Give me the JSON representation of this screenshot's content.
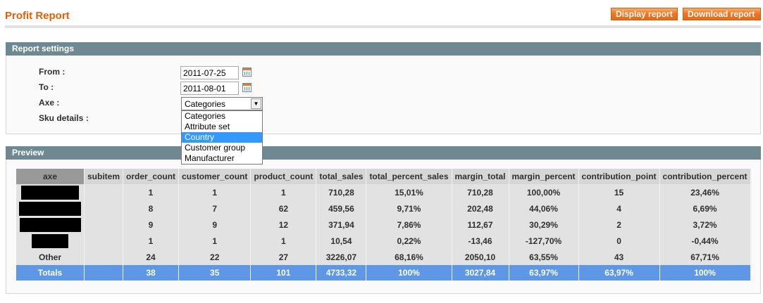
{
  "header": {
    "title": "Profit Report",
    "display_label": "Display report",
    "download_label": "Download report"
  },
  "settings": {
    "heading": "Report settings",
    "from_label": "From :",
    "from_value": "2011-07-25",
    "to_label": "To :",
    "to_value": "2011-08-01",
    "axe_label": "Axe :",
    "axe_value": "Categories",
    "sku_label": "Sku details :",
    "axe_options": [
      "Categories",
      "Attribute set",
      "Country",
      "Customer group",
      "Manufacturer"
    ],
    "highlighted_option": "Country"
  },
  "preview": {
    "heading": "Preview",
    "columns": [
      "axe",
      "subitem",
      "order_count",
      "customer_count",
      "product_count",
      "total_sales",
      "total_percent_sales",
      "margin_total",
      "margin_percent",
      "contribution_point",
      "contribution_percent"
    ],
    "rows": [
      {
        "axe": "",
        "redacted": true,
        "subitem": "",
        "order_count": "1",
        "customer_count": "1",
        "product_count": "1",
        "total_sales": "710,28",
        "total_percent_sales": "15,01%",
        "margin_total": "710,28",
        "margin_percent": "100,00%",
        "contribution_point": "15",
        "contribution_percent": "23,46%"
      },
      {
        "axe": "",
        "redacted": true,
        "subitem": "",
        "order_count": "8",
        "customer_count": "7",
        "product_count": "62",
        "total_sales": "459,56",
        "total_percent_sales": "9,71%",
        "margin_total": "202,48",
        "margin_percent": "44,06%",
        "contribution_point": "4",
        "contribution_percent": "6,69%"
      },
      {
        "axe": "",
        "redacted": true,
        "subitem": "",
        "order_count": "9",
        "customer_count": "9",
        "product_count": "12",
        "total_sales": "371,94",
        "total_percent_sales": "7,86%",
        "margin_total": "112,67",
        "margin_percent": "30,29%",
        "contribution_point": "2",
        "contribution_percent": "3,72%"
      },
      {
        "axe": "",
        "redacted": true,
        "subitem": "",
        "order_count": "1",
        "customer_count": "1",
        "product_count": "1",
        "total_sales": "10,54",
        "total_percent_sales": "0,22%",
        "margin_total": "-13,46",
        "margin_percent": "-127,70%",
        "contribution_point": "0",
        "contribution_percent": "-0,44%"
      },
      {
        "axe": "Other",
        "redacted": false,
        "subitem": "",
        "order_count": "24",
        "customer_count": "22",
        "product_count": "27",
        "total_sales": "3226,07",
        "total_percent_sales": "68,16%",
        "margin_total": "2050,10",
        "margin_percent": "63,55%",
        "contribution_point": "43",
        "contribution_percent": "67,71%"
      }
    ],
    "totals": {
      "axe": "Totals",
      "subitem": "",
      "order_count": "38",
      "customer_count": "35",
      "product_count": "101",
      "total_sales": "4733,32",
      "total_percent_sales": "100%",
      "margin_total": "3027,84",
      "margin_percent": "63,97%",
      "contribution_point": "63,97%",
      "contribution_percent": "100%"
    }
  },
  "icons": {
    "calendar": "calendar-icon",
    "dropdown": "chevron-down-icon"
  },
  "colors": {
    "accent": "#eb5e00",
    "button": "#ee7623",
    "section_header": "#6f8992",
    "totals_row": "#5d97e6",
    "selected_option": "#3399ff"
  }
}
